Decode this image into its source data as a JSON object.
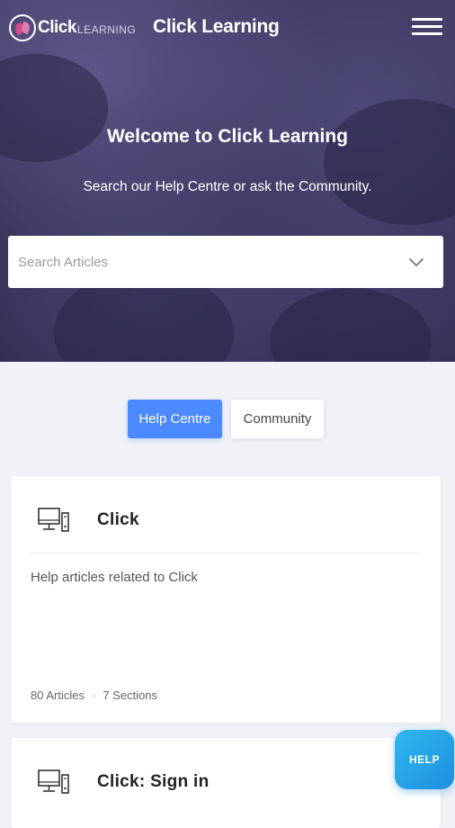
{
  "header": {
    "logo_primary": "Click",
    "logo_secondary": "LEARNING",
    "site_title": "Click Learning",
    "menu_icon": "hamburger-menu-icon"
  },
  "hero": {
    "title": "Welcome to Click Learning",
    "subtitle": "Search our Help Centre or ask the Community.",
    "search_placeholder": "Search Articles",
    "search_value": "",
    "dropdown_icon": "chevron-down-icon"
  },
  "tabs": [
    {
      "label": "Help Centre",
      "active": true
    },
    {
      "label": "Community",
      "active": false
    }
  ],
  "categories": [
    {
      "icon": "computer-icon",
      "title": "Click",
      "description": "Help articles related to Click",
      "articles": "80 Articles",
      "sections": "7 Sections"
    },
    {
      "icon": "computer-icon",
      "title": "Click: Sign in"
    }
  ],
  "help_button": {
    "label": "HELP"
  },
  "colors": {
    "accent": "#4b89ff",
    "help_button": "#2aa8ea",
    "hero_overlay": "#3a3660",
    "page_background": "#f0f2f7"
  }
}
